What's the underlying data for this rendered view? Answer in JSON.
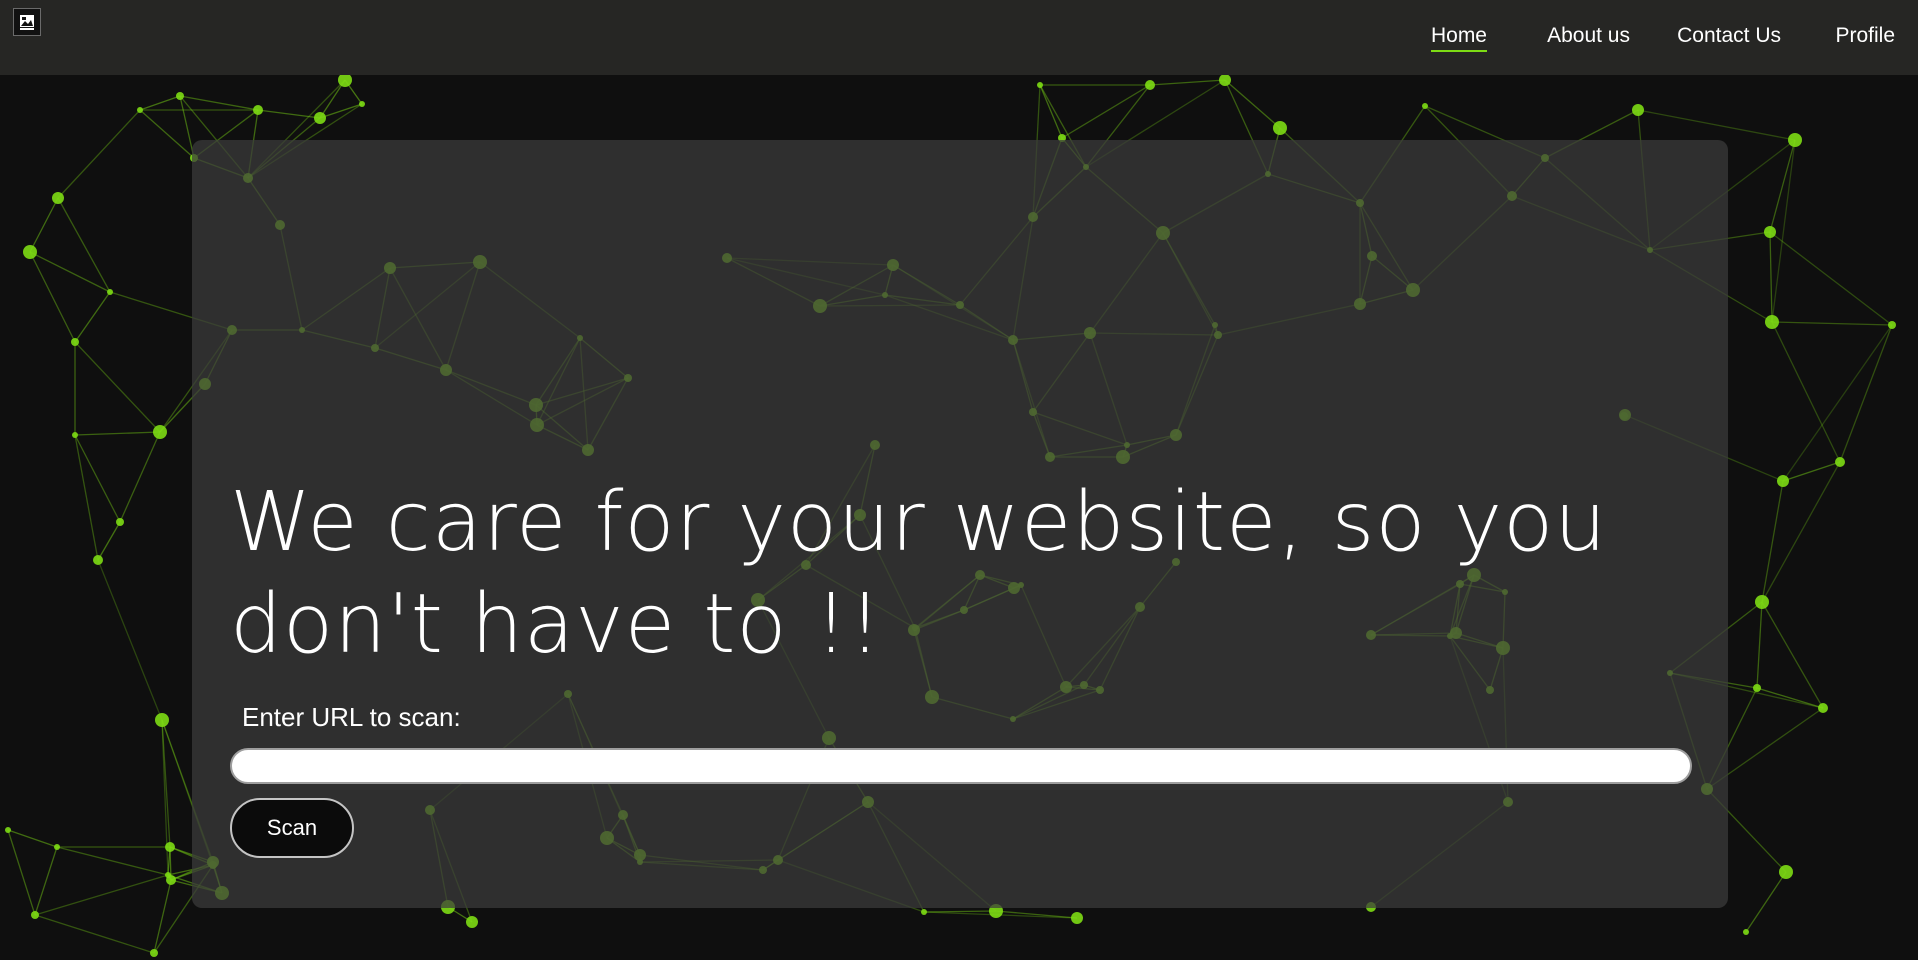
{
  "navbar": {
    "logo_icon": "image-icon",
    "links": [
      {
        "label": "Home",
        "active": true
      },
      {
        "label": "About us",
        "active": false
      },
      {
        "label": "Contact Us",
        "active": false
      },
      {
        "label": "Profile",
        "active": false
      }
    ]
  },
  "hero": {
    "headline": "We care for your website, so you don't have to !!",
    "url_label": "Enter URL to scan:",
    "url_value": "",
    "url_placeholder": "",
    "scan_button": "Scan"
  },
  "background": {
    "style": "green particle network on dark background",
    "accent_color": "#7ddb14",
    "background_color": "#0f0f0f",
    "card_color": "#3a3a3a"
  }
}
